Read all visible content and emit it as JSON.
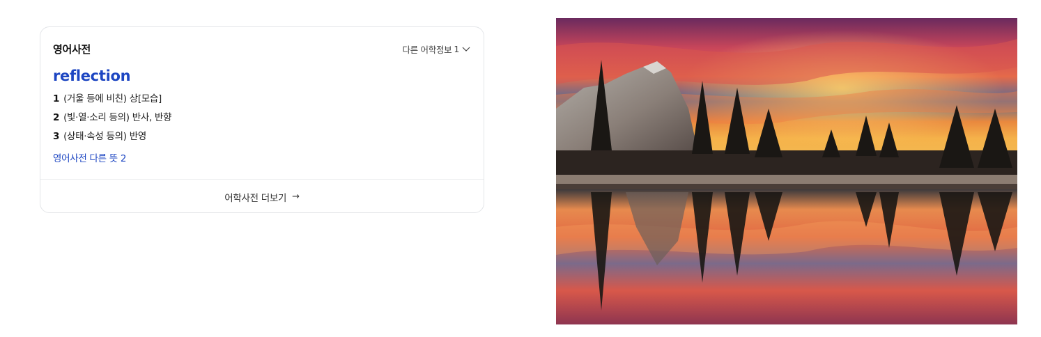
{
  "dictionary": {
    "title": "영어사전",
    "other_info_label": "다른 어학정보",
    "other_info_count": "1",
    "headword": "reflection",
    "senses": [
      {
        "num": "1",
        "text": "(거울 등에 비친) 상[모습]"
      },
      {
        "num": "2",
        "text": "(빛·열·소리 등의) 반사, 반향"
      },
      {
        "num": "3",
        "text": "(상태·속성 등의) 반영"
      }
    ],
    "more_senses_label": "영어사전 다른 뜻",
    "more_senses_count": "2",
    "footer_label": "어학사전 더보기",
    "footer_arrow": "→"
  },
  "colors": {
    "accent_blue": "#1d46c2",
    "border": "#e3e5e8"
  },
  "icons": {
    "chevron": "chevron-down-icon",
    "arrow": "arrow-right-icon"
  }
}
